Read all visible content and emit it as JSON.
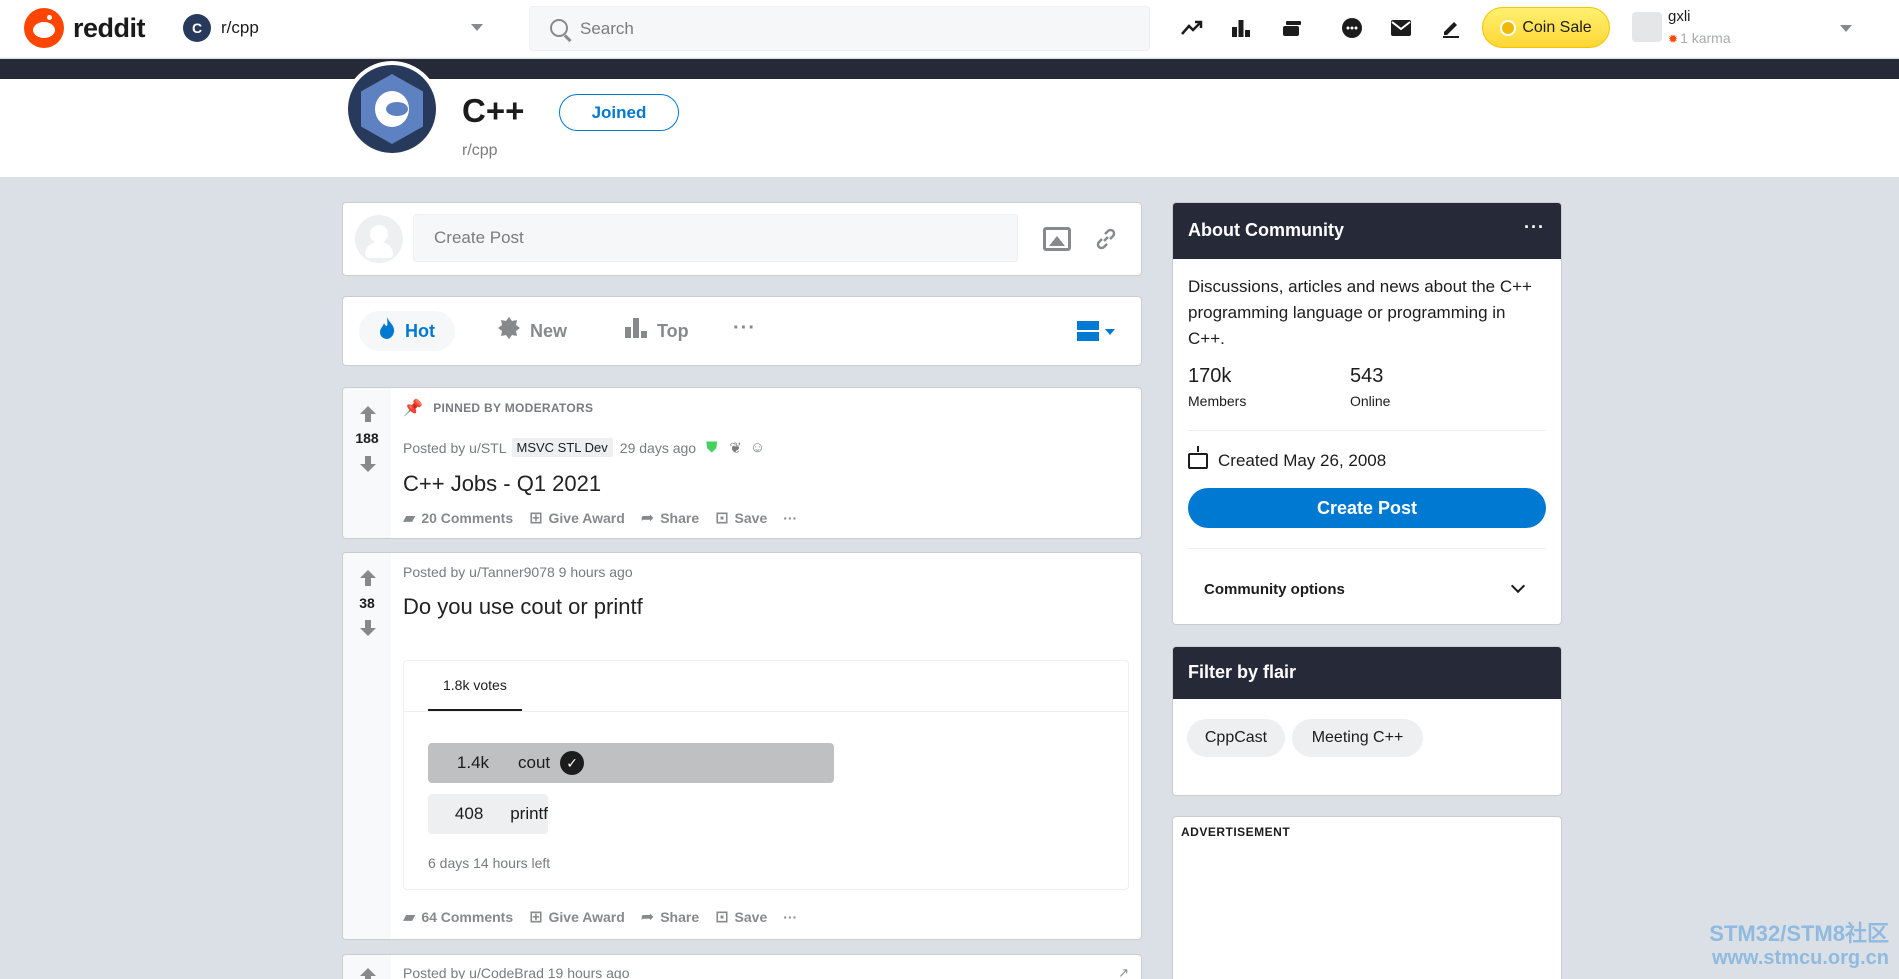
{
  "header": {
    "logo_text": "reddit",
    "community": "r/cpp",
    "search_placeholder": "Search",
    "coin_sale": "Coin Sale",
    "user_name": "gxli",
    "user_karma": "1 karma"
  },
  "community": {
    "name": "C++",
    "slug": "r/cpp",
    "joined_label": "Joined",
    "logo_initial": "C"
  },
  "create_post": {
    "placeholder": "Create Post"
  },
  "sort": {
    "hot": "Hot",
    "new": "New",
    "top": "Top",
    "more": "···"
  },
  "posts": [
    {
      "pinned_label": "PINNED BY MODERATORS",
      "votes": "188",
      "posted_by": "Posted by u/STL",
      "flair": "MSVC STL Dev",
      "time": "29 days ago",
      "title": "C++ Jobs - Q1 2021",
      "comments": "20 Comments",
      "award": "Give Award",
      "share": "Share",
      "save": "Save"
    },
    {
      "votes": "38",
      "posted_by": "Posted by u/Tanner9078 9 hours ago",
      "title": "Do you use cout or printf",
      "poll": {
        "total_votes": "1.8k votes",
        "options": [
          {
            "count": "1.4k",
            "label": "cout",
            "fraction": 0.78
          },
          {
            "count": "408",
            "label": "printf",
            "fraction": 0.23
          }
        ],
        "time_left": "6 days 14 hours left"
      },
      "comments": "64 Comments",
      "award": "Give Award",
      "share": "Share",
      "save": "Save"
    },
    {
      "posted_by": "Posted by u/CodeBrad 19 hours ago"
    }
  ],
  "about": {
    "title": "About Community",
    "description": "Discussions, articles and news about the C++ programming language or programming in C++.",
    "members_count": "170k",
    "members_label": "Members",
    "online_count": "543",
    "online_label": "Online",
    "created": "Created May 26, 2008",
    "create_post_btn": "Create Post",
    "community_options": "Community options"
  },
  "flair_filter": {
    "title": "Filter by flair",
    "flairs": [
      "CppCast",
      "Meeting C++"
    ]
  },
  "advertisement_label": "ADVERTISEMENT",
  "watermark": {
    "line1": "STM32/STM8社区",
    "line2": "www.stmcu.org.cn"
  },
  "colors": {
    "brand": "#ff4500",
    "accent": "#0079d3",
    "dark_header": "#262938",
    "coin": "#ffd635"
  }
}
